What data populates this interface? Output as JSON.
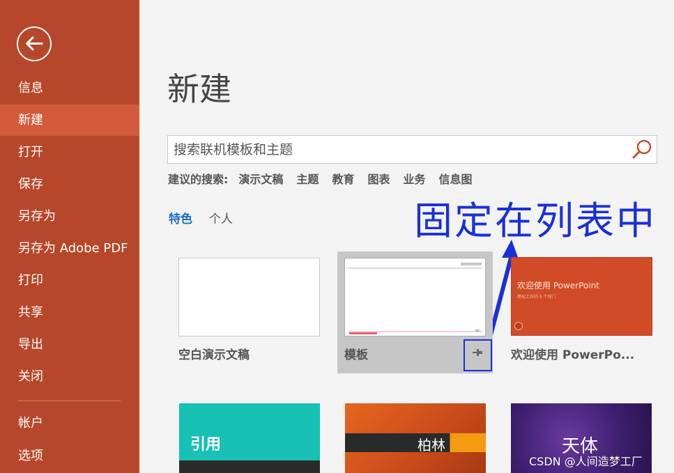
{
  "sidebar": {
    "back_icon": "arrow-left-circle-icon",
    "items": [
      {
        "label": "信息"
      },
      {
        "label": "新建"
      },
      {
        "label": "打开"
      },
      {
        "label": "保存"
      },
      {
        "label": "另存为"
      },
      {
        "label": "另存为 Adobe PDF"
      },
      {
        "label": "打印"
      },
      {
        "label": "共享"
      },
      {
        "label": "导出"
      },
      {
        "label": "关闭"
      },
      {
        "label": "帐户"
      },
      {
        "label": "选项"
      }
    ],
    "active_index": 1,
    "colors": {
      "background": "#b7472a",
      "active": "#d35a3b"
    }
  },
  "main": {
    "title": "新建",
    "search": {
      "placeholder": "搜索联机模板和主题",
      "icon": "search-icon"
    },
    "suggested": {
      "label": "建议的搜索:",
      "items": [
        "演示文稿",
        "主题",
        "教育",
        "图表",
        "业务",
        "信息图"
      ]
    },
    "tabs": [
      {
        "label": "特色",
        "active": true
      },
      {
        "label": "个人",
        "active": false
      }
    ],
    "annotation": "固定在列表中",
    "templates": [
      {
        "label": "空白演示文稿"
      },
      {
        "label": "模板",
        "pin_icon": "pin-icon"
      },
      {
        "label": "欢迎使用 PowerPo...",
        "thumb_title": "欢迎使用 PowerPoint",
        "thumb_subtitle": "简化工作的 5 个窍门"
      },
      {
        "thumb_text": "引用"
      },
      {
        "thumb_text": "柏林"
      },
      {
        "thumb_text": "天体"
      }
    ],
    "watermark": "CSDN @人间造梦工厂"
  }
}
